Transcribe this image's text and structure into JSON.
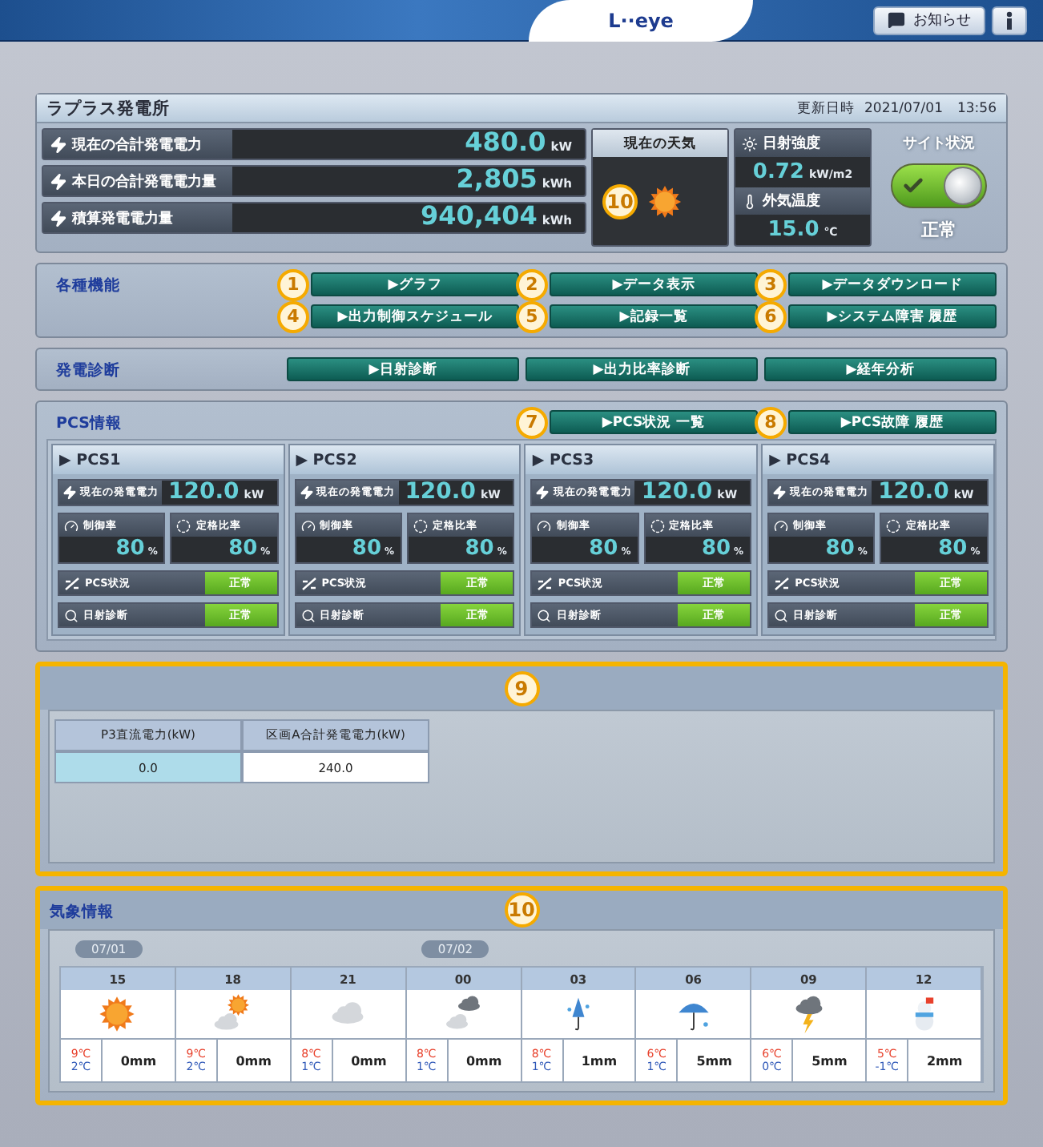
{
  "header": {
    "logo": "L··eye",
    "notice_button": "お知らせ"
  },
  "plant": {
    "name": "ラプラス発電所",
    "updated_label": "更新日時",
    "updated_at": "2021/07/01　13:56",
    "metrics": [
      {
        "label": "現在の合計発電電力",
        "value": "480.0",
        "unit": "kW"
      },
      {
        "label": "本日の合計発電電力量",
        "value": "2,805",
        "unit": "kWh"
      },
      {
        "label": "積算発電電力量",
        "value": "940,404",
        "unit": "kWh"
      }
    ],
    "weather": {
      "title": "現在の天気",
      "marker": "10",
      "kind": "sun"
    },
    "solar": {
      "label": "日射強度",
      "value": "0.72",
      "unit": "kW/m2"
    },
    "temperature": {
      "label": "外気温度",
      "value": "15.0",
      "unit": "℃"
    },
    "site_status": {
      "label": "サイト状況",
      "on": true,
      "status": "正常"
    }
  },
  "functions": {
    "title": "各種機能",
    "buttons": [
      {
        "label": "▶グラフ",
        "marker": "1"
      },
      {
        "label": "▶データ表示",
        "marker": "2"
      },
      {
        "label": "▶データダウンロード",
        "marker": "3"
      },
      {
        "label": "▶出力制御スケジュール",
        "marker": "4"
      },
      {
        "label": "▶記録一覧",
        "marker": "5"
      },
      {
        "label": "▶システム障害 履歴",
        "marker": "6"
      }
    ]
  },
  "diagnosis": {
    "title": "発電診断",
    "buttons": [
      "▶日射診断",
      "▶出力比率診断",
      "▶経年分析"
    ]
  },
  "pcs": {
    "title": "PCS情報",
    "buttons": [
      {
        "label": "▶PCS状況 一覧",
        "marker": "7"
      },
      {
        "label": "▶PCS故障 履歴",
        "marker": "8"
      }
    ],
    "units": [
      {
        "name": "▶ PCS1",
        "power_label": "現在の発電電力",
        "power": "120.0",
        "unit": "kW",
        "control_label": "制御率",
        "control": "80",
        "rated_label": "定格比率",
        "rated": "80",
        "percent": "%",
        "status_label": "PCS状況",
        "status": "正常",
        "solar_label": "日射診断",
        "solar_status": "正常"
      },
      {
        "name": "▶ PCS2",
        "power_label": "現在の発電電力",
        "power": "120.0",
        "unit": "kW",
        "control_label": "制御率",
        "control": "80",
        "rated_label": "定格比率",
        "rated": "80",
        "percent": "%",
        "status_label": "PCS状況",
        "status": "正常",
        "solar_label": "日射診断",
        "solar_status": "正常"
      },
      {
        "name": "▶ PCS3",
        "power_label": "現在の発電電力",
        "power": "120.0",
        "unit": "kW",
        "control_label": "制御率",
        "control": "80",
        "rated_label": "定格比率",
        "rated": "80",
        "percent": "%",
        "status_label": "PCS状況",
        "status": "正常",
        "solar_label": "日射診断",
        "solar_status": "正常"
      },
      {
        "name": "▶ PCS4",
        "power_label": "現在の発電電力",
        "power": "120.0",
        "unit": "kW",
        "control_label": "制御率",
        "control": "80",
        "rated_label": "定格比率",
        "rated": "80",
        "percent": "%",
        "status_label": "PCS状況",
        "status": "正常",
        "solar_label": "日射診断",
        "solar_status": "正常"
      }
    ]
  },
  "custom": {
    "marker": "9",
    "highlighted": true,
    "columns": [
      "P3直流電力(kW)",
      "区画A合計発電電力(kW)"
    ],
    "cells": [
      {
        "text": "0.0",
        "selected": true
      },
      {
        "text": "240.0",
        "selected": false
      }
    ]
  },
  "forecast": {
    "title": "気象情報",
    "marker": "10",
    "highlighted": true,
    "hours": [
      {
        "date": "07/01",
        "hour": "15",
        "kind": "sun",
        "high": "9℃",
        "low": "2℃",
        "rain": "0mm"
      },
      {
        "hour": "18",
        "kind": "sun_cloud",
        "high": "9℃",
        "low": "2℃",
        "rain": "0mm"
      },
      {
        "hour": "21",
        "kind": "cloud",
        "high": "8℃",
        "low": "1℃",
        "rain": "0mm"
      },
      {
        "date": "07/02",
        "hour": "00",
        "kind": "clouds",
        "high": "8℃",
        "low": "1℃",
        "rain": "0mm"
      },
      {
        "hour": "03",
        "kind": "drizzle",
        "high": "8℃",
        "low": "1℃",
        "rain": "1mm"
      },
      {
        "hour": "06",
        "kind": "rain",
        "high": "6℃",
        "low": "1℃",
        "rain": "5mm"
      },
      {
        "hour": "09",
        "kind": "thunder",
        "high": "6℃",
        "low": "0℃",
        "rain": "5mm"
      },
      {
        "hour": "12",
        "kind": "snow",
        "high": "5℃",
        "low": "-1℃",
        "rain": "2mm"
      }
    ]
  }
}
